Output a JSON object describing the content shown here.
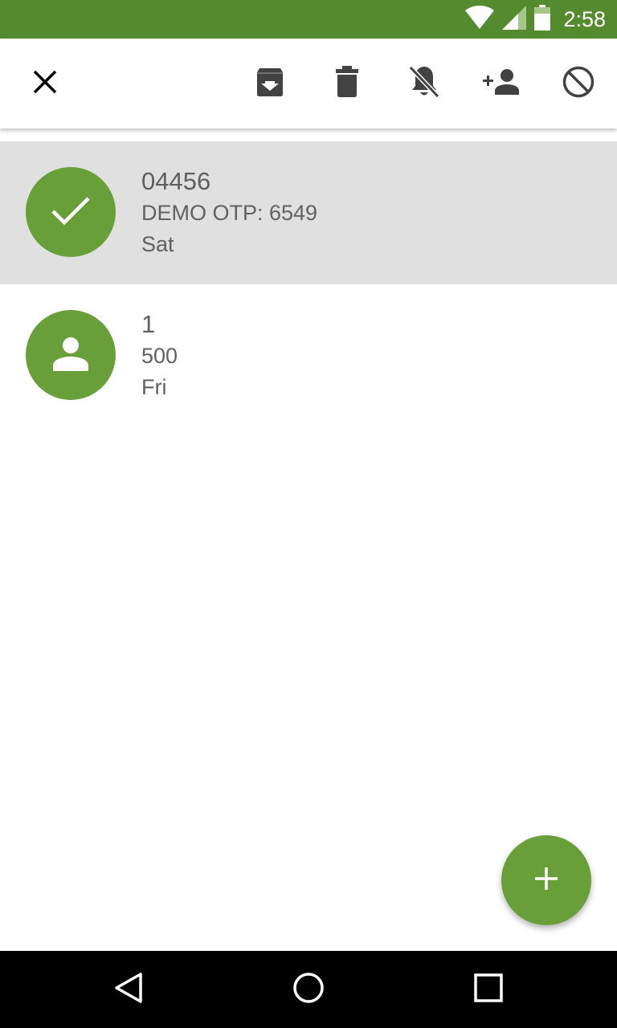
{
  "status_bar": {
    "time": "2:58",
    "icons": [
      "wifi-icon",
      "cell-signal-icon",
      "battery-icon"
    ],
    "color": "#558b2f"
  },
  "action_bar": {
    "actions": [
      "close-icon",
      "archive-icon",
      "delete-icon",
      "notifications-off-icon",
      "add-contact-icon",
      "block-icon"
    ]
  },
  "conversations": [
    {
      "title": "04456",
      "snippet": "DEMO OTP: 6549",
      "time": "Sat",
      "selected": true,
      "avatar_icon": "check-icon"
    },
    {
      "title": "1",
      "snippet": "500",
      "time": "Fri",
      "selected": false,
      "avatar_icon": "person-icon"
    }
  ],
  "fab": {
    "icon": "plus-icon",
    "color": "#689f38"
  },
  "nav_bar": {
    "buttons": [
      "back-icon",
      "home-icon",
      "recents-icon"
    ]
  },
  "colors": {
    "accent": "#689f38",
    "status_bar": "#558b2f",
    "selected_row": "#e0e0e0"
  }
}
